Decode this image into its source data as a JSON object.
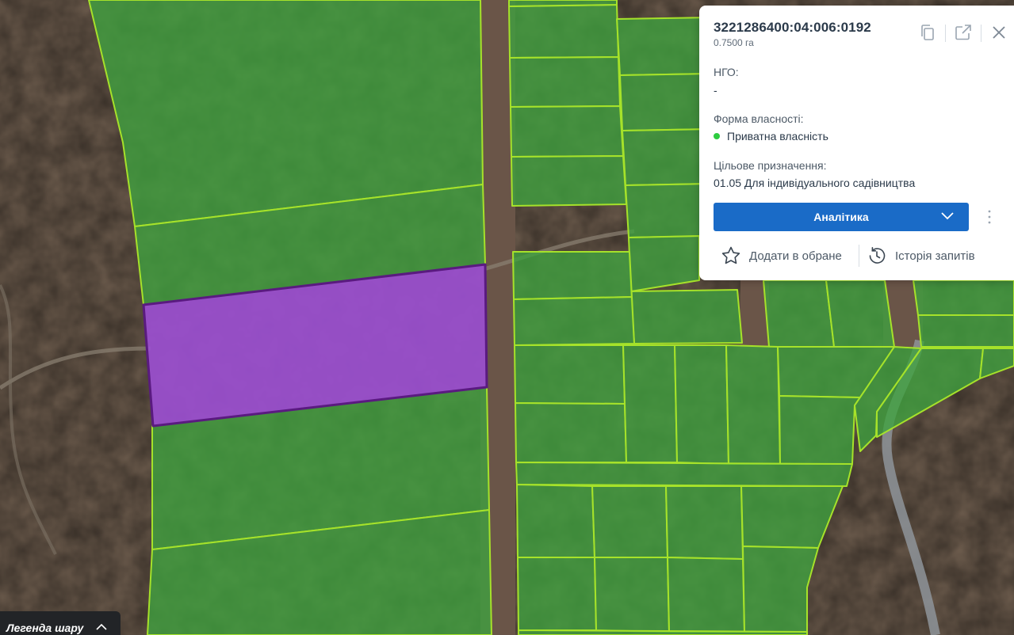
{
  "parcel": {
    "cadastral_number": "3221286400:04:006:0192",
    "area": "0.7500 га",
    "ngo_label": "НГО:",
    "ngo_value": "-",
    "ownership_label": "Форма власності:",
    "ownership_value": "Приватна власність",
    "ownership_color": "#2ecc40",
    "purpose_label": "Цільове призначення:",
    "purpose_value": "01.05 Для індивідуального садівництва"
  },
  "actions": {
    "analytics_button": "Аналітика",
    "add_favorite": "Додати в обране",
    "query_history": "Історія запитів"
  },
  "header_icons": [
    "copy-icon",
    "open-external-icon",
    "close-icon"
  ],
  "legend": {
    "toggle_label": "Легенда шару"
  },
  "colors": {
    "accent": "#1a6bc7",
    "parcel_fill": "#3fa33f",
    "parcel_border": "#a6e22a",
    "selected_fill": "#9b4fd0",
    "selected_border": "#5a1a80"
  }
}
